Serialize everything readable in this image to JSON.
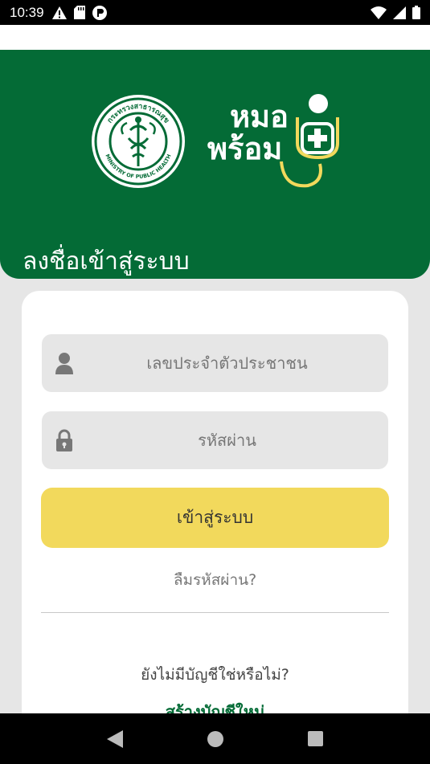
{
  "status_bar": {
    "time": "10:39",
    "left_icons": [
      "warning-icon",
      "sd-card-icon",
      "app-notification-icon"
    ],
    "right_icons": [
      "wifi-icon",
      "signal-icon",
      "battery-icon"
    ]
  },
  "header": {
    "logo_left": "ministry-of-public-health-seal",
    "logo_right_line1": "หมอ",
    "logo_right_line2": "พร้อม",
    "title": "ลงชื่อเข้าสู่ระบบ",
    "background_color": "#046b36"
  },
  "form": {
    "id_field": {
      "placeholder": "เลขประจำตัวประชาชน",
      "value": ""
    },
    "password_field": {
      "placeholder": "รหัสผ่าน",
      "value": ""
    },
    "login_label": "เข้าสู่ระบบ",
    "forgot_password": "ลืมรหัสผ่าน?",
    "no_account": "ยังไม่มีบัญชีใช่หรือไม่?",
    "create_account": "สร้างบัญชีใหม่",
    "accent_color": "#f2d95c"
  },
  "nav_bar": {
    "buttons": [
      "back-icon",
      "home-icon",
      "recents-icon"
    ]
  }
}
